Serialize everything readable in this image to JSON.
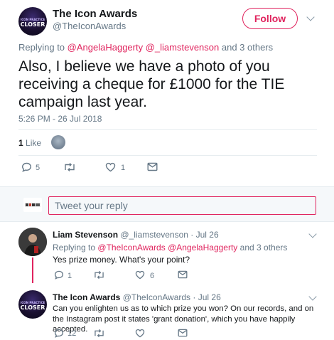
{
  "main_tweet": {
    "author_name": "The Icon Awards",
    "author_handle": "@TheIconAwards",
    "avatar_text_top": "ICON PRACTICE",
    "avatar_text_bottom": "CLOSER",
    "follow_label": "Follow",
    "replying_to_prefix": "Replying to",
    "replying_mentions": "@AngelaHaggerty @_liamstevenson",
    "replying_suffix": "and 3 others",
    "text": "Also, I believe we have a photo of you receiving a cheque for £1000 for the TIE campaign last year.",
    "timestamp": "5:26 PM - 26 Jul 2018",
    "like_count": "1",
    "like_label": "Like",
    "action_reply_count": "5",
    "action_like_count": "1"
  },
  "reply_composer": {
    "placeholder": "Tweet your reply"
  },
  "replies": [
    {
      "author_name": "Liam Stevenson",
      "author_handle": "@_liamstevenson",
      "date": "· Jul 26",
      "replying_to_prefix": "Replying to",
      "replying_mentions": "@TheIconAwards @AngelaHaggerty",
      "replying_suffix": "and 3 others",
      "text": "Yes prize money. What's your point?",
      "reply_count": "1",
      "like_count": "6"
    },
    {
      "author_name": "The Icon Awards",
      "author_handle": "@TheIconAwards",
      "date": "· Jul 26",
      "avatar_text_top": "ICON PRACTICE",
      "avatar_text_bottom": "CLOSER",
      "text": "Can you enlighten us as to which prize you won? On our records, and on the Instagram post it states 'grant donation', which you have happily accepted.",
      "reply_count": "12"
    }
  ],
  "colors": {
    "accent": "#e0245e",
    "muted": "#657786",
    "thread_line": "#e0245e"
  }
}
